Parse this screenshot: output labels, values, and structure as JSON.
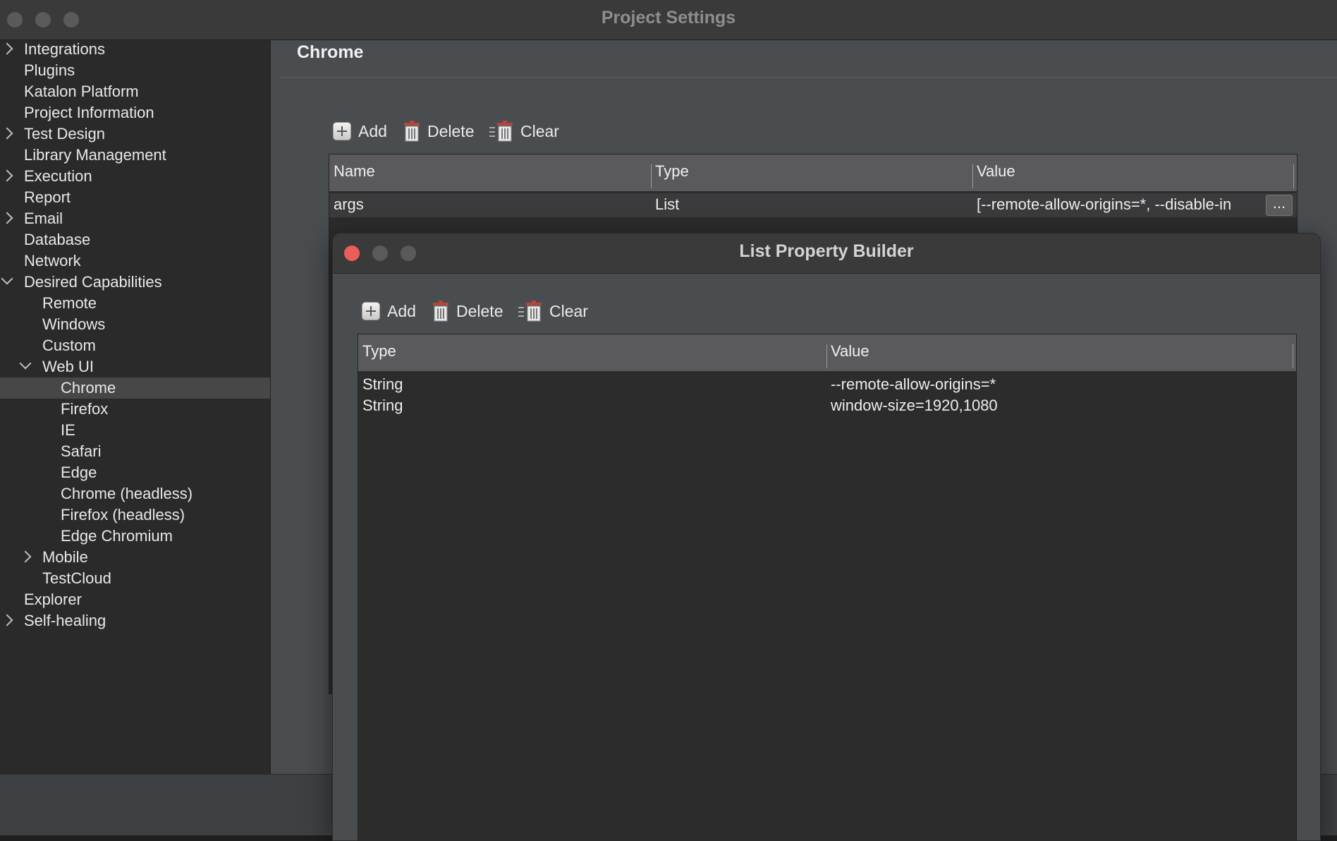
{
  "window": {
    "title": "Project Settings"
  },
  "sidebar": {
    "items": [
      {
        "label": "Integrations",
        "expander": "right"
      },
      {
        "label": "Plugins"
      },
      {
        "label": "Katalon Platform"
      },
      {
        "label": "Project Information"
      },
      {
        "label": "Test Design",
        "expander": "right"
      },
      {
        "label": "Library Management"
      },
      {
        "label": "Execution",
        "expander": "right"
      },
      {
        "label": "Report"
      },
      {
        "label": "Email",
        "expander": "right"
      },
      {
        "label": "Database"
      },
      {
        "label": "Network"
      },
      {
        "label": "Desired Capabilities",
        "expander": "down"
      },
      {
        "label": "Remote"
      },
      {
        "label": "Windows"
      },
      {
        "label": "Custom"
      },
      {
        "label": "Web UI",
        "expander": "down"
      },
      {
        "label": "Chrome",
        "selected": true
      },
      {
        "label": "Firefox"
      },
      {
        "label": "IE"
      },
      {
        "label": "Safari"
      },
      {
        "label": "Edge"
      },
      {
        "label": "Chrome (headless)"
      },
      {
        "label": "Firefox (headless)"
      },
      {
        "label": "Edge Chromium"
      },
      {
        "label": "Mobile",
        "expander": "right"
      },
      {
        "label": "TestCloud"
      },
      {
        "label": "Explorer"
      },
      {
        "label": "Self-healing",
        "expander": "right"
      }
    ]
  },
  "main": {
    "title": "Chrome",
    "toolbar": {
      "add": "Add",
      "delete": "Delete",
      "clear": "Clear"
    },
    "table": {
      "columns": [
        "Name",
        "Type",
        "Value"
      ],
      "rows": [
        {
          "name": "args",
          "type": "List",
          "value": "[--remote-allow-origins=*, --disable-in",
          "action": "..."
        }
      ]
    }
  },
  "dialog": {
    "title": "List Property Builder",
    "toolbar": {
      "add": "Add",
      "delete": "Delete",
      "clear": "Clear"
    },
    "table": {
      "columns": [
        "Type",
        "Value"
      ],
      "rows": [
        {
          "type": "String",
          "value": "--remote-allow-origins=*"
        },
        {
          "type": "String",
          "value": "window-size=1920,1080"
        }
      ]
    }
  },
  "colors": {
    "close": "#ec5f57",
    "inactive_traffic": "#5a5a5a",
    "selection": "#474747"
  }
}
